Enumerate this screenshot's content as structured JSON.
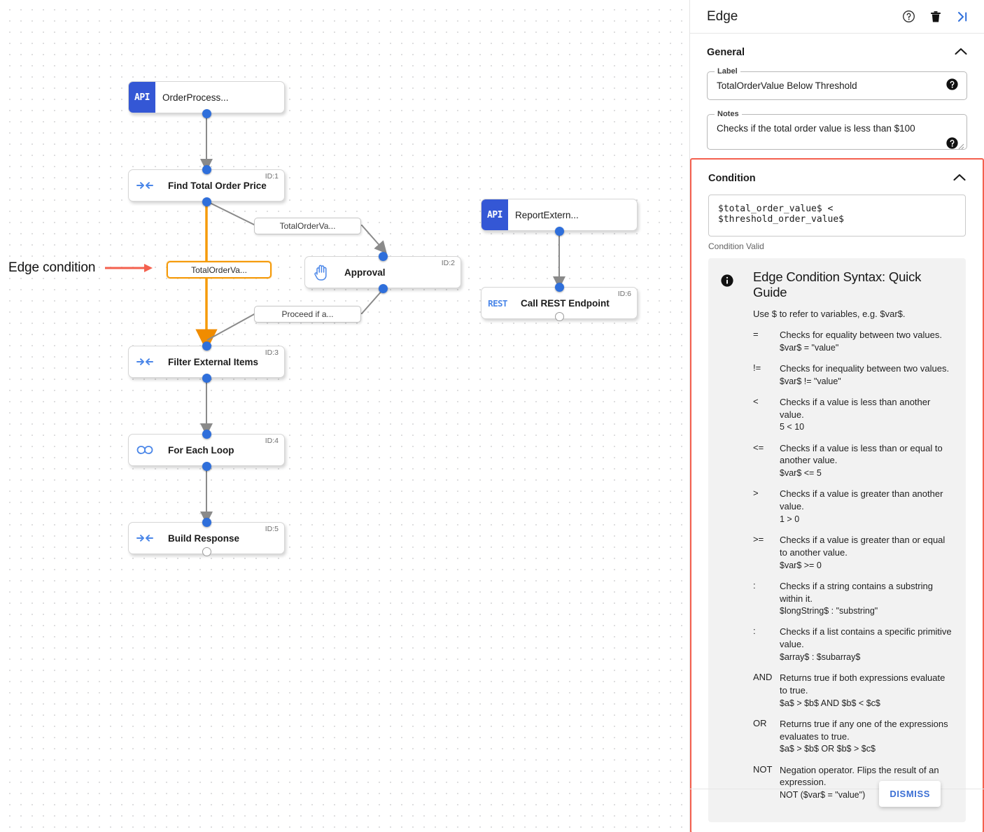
{
  "canvas": {
    "annotation": {
      "text": "Edge condition",
      "arrow_color": "#f4604e"
    },
    "nodes": [
      {
        "name": "OrderProcess...",
        "badge": "API",
        "id_tag": "",
        "kind": "api"
      },
      {
        "name": "Find Total Order Price",
        "badge": "",
        "id_tag": "ID:1",
        "kind": "transform"
      },
      {
        "name": "Approval",
        "badge": "",
        "id_tag": "ID:2",
        "kind": "approval"
      },
      {
        "name": "Filter External Items",
        "badge": "",
        "id_tag": "ID:3",
        "kind": "transform"
      },
      {
        "name": "For Each Loop",
        "badge": "",
        "id_tag": "ID:4",
        "kind": "loop"
      },
      {
        "name": "Build Response",
        "badge": "",
        "id_tag": "ID:5",
        "kind": "transform"
      },
      {
        "name": "ReportExtern...",
        "badge": "API",
        "id_tag": "",
        "kind": "api"
      },
      {
        "name": "Call REST Endpoint",
        "badge": "REST",
        "id_tag": "ID:6",
        "kind": "rest"
      }
    ],
    "edge_labels": [
      {
        "text": "TotalOrderVa...",
        "selected": false
      },
      {
        "text": "TotalOrderVa...",
        "selected": true
      },
      {
        "text": "Proceed if a...",
        "selected": false
      }
    ]
  },
  "panel": {
    "title": "Edge",
    "header_icons": [
      "help-circle-icon",
      "trash-icon",
      "collapse-panel-icon"
    ],
    "general": {
      "heading": "General",
      "label_legend": "Label",
      "label_value": "TotalOrderValue Below Threshold",
      "notes_legend": "Notes",
      "notes_value": "Checks if the total order value is less than $100"
    },
    "condition": {
      "heading": "Condition",
      "expression": "$total_order_value$ < $threshold_order_value$",
      "status": "Condition Valid",
      "highlight_color": "#f4604e"
    },
    "guide": {
      "title": "Edge Condition Syntax: Quick Guide",
      "intro": "Use $ to refer to variables, e.g. $var$.",
      "operators": [
        {
          "symbol": "=",
          "description": "Checks for equality between two values.",
          "example": "$var$ = \"value\""
        },
        {
          "symbol": "!=",
          "description": "Checks for inequality between two values.",
          "example": "$var$ != \"value\""
        },
        {
          "symbol": "<",
          "description": "Checks if a value is less than another value.",
          "example": "5 < 10"
        },
        {
          "symbol": "<=",
          "description": "Checks if a value is less than or equal to another value.",
          "example": "$var$ <= 5"
        },
        {
          "symbol": ">",
          "description": "Checks if a value is greater than another value.",
          "example": "1 > 0"
        },
        {
          "symbol": ">=",
          "description": "Checks if a value is greater than or equal to another value.",
          "example": "$var$ >= 0"
        },
        {
          "symbol": ":",
          "description": "Checks if a string contains a substring within it.",
          "example": "$longString$ : \"substring\""
        },
        {
          "symbol": ":",
          "description": "Checks if a list contains a specific primitive value.",
          "example": "$array$ : $subarray$"
        },
        {
          "symbol": "AND",
          "description": "Returns true if both expressions evaluate to true.",
          "example": "$a$ > $b$ AND $b$ < $c$"
        },
        {
          "symbol": "OR",
          "description": "Returns true if any one of the expressions evaluates to true.",
          "example": "$a$ > $b$ OR $b$ > $c$"
        },
        {
          "symbol": "NOT",
          "description": "Negation operator. Flips the result of an expression.",
          "example": "NOT ($var$ = \"value\")"
        }
      ]
    },
    "dismiss_label": "DISMISS"
  }
}
